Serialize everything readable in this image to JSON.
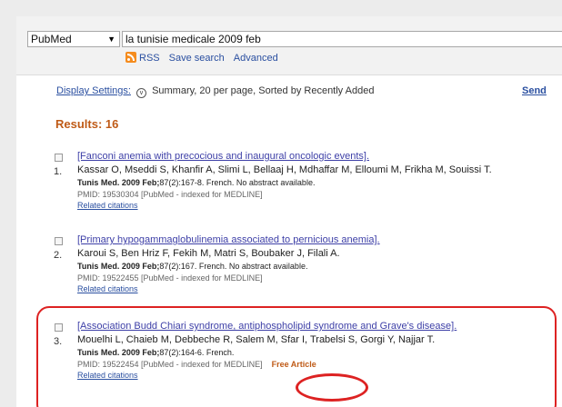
{
  "search": {
    "database": "PubMed",
    "term": "la tunisie medicale 2009 feb",
    "links": [
      "RSS",
      "Save search",
      "Advanced"
    ]
  },
  "display": {
    "settings_label": "Display Settings:",
    "settings_value": "Summary, 20 per page, Sorted by Recently Added",
    "send_to": "Send"
  },
  "results": {
    "count_label": "Results: 16",
    "items": [
      {
        "number": "1.",
        "title": "[Fanconi anemia with precocious and inaugural oncologic events].",
        "authors": "Kassar O, Mseddi S, Khanfir A, Slimi L, Bellaaj H, Mdhaffar M, Elloumi M, Frikha M, Souissi T.",
        "journal": "Tunis Med. 2009 Feb;",
        "citation": "87(2):167-8. French. No abstract available.",
        "pmid": "PMID: 19530304 [PubMed - indexed for MEDLINE]",
        "related": "Related citations"
      },
      {
        "number": "2.",
        "title": "[Primary hypogammaglobulinemia associated to pernicious anemia].",
        "authors": "Karoui S, Ben Hriz F, Fekih M, Matri S, Boubaker J, Filali A.",
        "journal": "Tunis Med. 2009 Feb;",
        "citation": "87(2):167. French. No abstract available.",
        "pmid": "PMID: 19522455 [PubMed - indexed for MEDLINE]",
        "related": "Related citations"
      },
      {
        "number": "3.",
        "title": "[Association Budd Chiari syndrome, antiphospholipid syndrome and Grave's disease].",
        "authors": "Mouelhi L, Chaieb M, Debbeche R, Salem M, Sfar I, Trabelsi S, Gorgi Y, Najjar T.",
        "journal": "Tunis Med. 2009 Feb;",
        "citation": "87(2):164-6. French.",
        "pmid": "PMID: 19522454 [PubMed - indexed for MEDLINE]",
        "free_article": "Free Article",
        "related": "Related citations"
      }
    ]
  },
  "colors": {
    "results_heading": "#bf5a16",
    "title_link": "#3d3fa7",
    "annotation_red": "#d22"
  }
}
